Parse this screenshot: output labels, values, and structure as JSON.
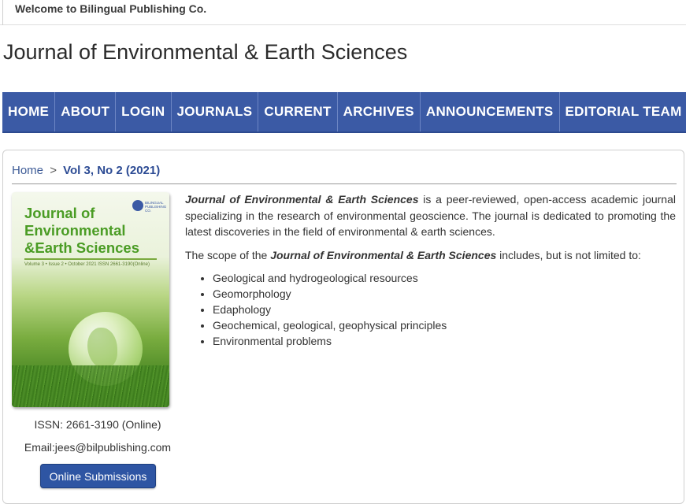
{
  "header": {
    "welcome": "Welcome to Bilingual Publishing Co.",
    "site_title": "Journal of Environmental & Earth Sciences"
  },
  "nav": {
    "items": [
      {
        "label": "HOME"
      },
      {
        "label": "ABOUT"
      },
      {
        "label": "LOGIN"
      },
      {
        "label": "JOURNALS"
      },
      {
        "label": "CURRENT"
      },
      {
        "label": "ARCHIVES"
      },
      {
        "label": "ANNOUNCEMENTS"
      },
      {
        "label": "EDITORIAL TEAM"
      }
    ]
  },
  "breadcrumb": {
    "home": "Home",
    "separator": ">",
    "current": "Vol 3, No 2 (2021)"
  },
  "cover": {
    "title": "Journal of Environmental &Earth Sciences",
    "meta": "Volume 3 • Issue 2 • October 2021  ISSN  2661-3190(Online)",
    "publisher_logo_text": "BILINGUAL PUBLISHING CO."
  },
  "sidebar": {
    "issn": "ISSN: 2661-3190 (Online)",
    "email": "Email:jees@bilpublishing.com",
    "submit_label": "Online Submissions"
  },
  "main": {
    "intro_journal": "Journal of Environmental & Earth Sciences",
    "intro_text": " is a peer-reviewed, open-access academic journal specializing in the research of environmental geoscience. The journal is dedicated to promoting the latest discoveries in the field of environmental & earth sciences.",
    "scope_prefix": "The scope of the ",
    "scope_journal": "Journal of Environmental & Earth Sciences",
    "scope_suffix": "  includes, but is not limited to:",
    "scope_items": [
      "Geological and hydrogeological resources",
      "Geomorphology",
      "Edaphology",
      "Geochemical, geological, geophysical principles",
      "Environmental problems"
    ]
  },
  "colors": {
    "nav_bg": "#3b5aa5",
    "button_bg": "#2e55a3",
    "link": "#3c5a96"
  }
}
